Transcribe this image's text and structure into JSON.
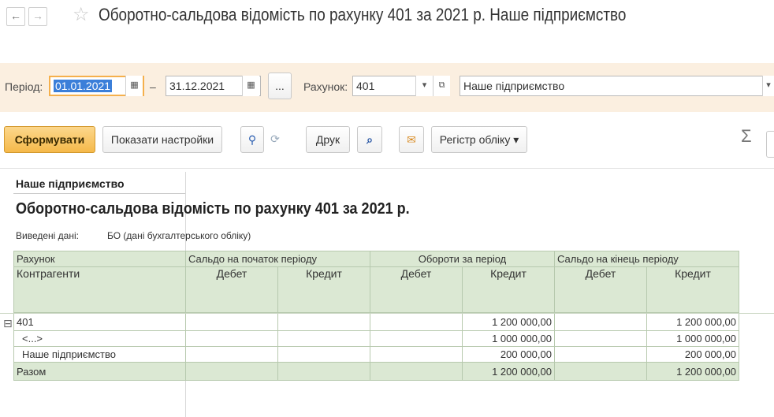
{
  "window": {
    "title": "Оборотно-сальдова відомість по рахунку 401 за 2021 р. Наше підприємство",
    "back_icon": "←",
    "forward_icon": "→",
    "favorite_icon": "☆"
  },
  "params": {
    "period_label": "Період:",
    "date_from": "01.01.2021",
    "dash": "–",
    "date_to": "31.12.2021",
    "more_btn": "...",
    "account_label": "Рахунок:",
    "account_value": "401",
    "organization_value": "Наше підприємство"
  },
  "toolbar": {
    "form_btn": "Сформувати",
    "show_settings_btn": "Показати настройки",
    "print_btn": "Друк",
    "register_btn": "Регістр обліку ▾",
    "sum_icon": "Σ"
  },
  "report": {
    "org": "Наше підприємство",
    "title": "Оборотно-сальдова відомість по рахунку 401 за 2021 р.",
    "entered_label": "Виведені дані:",
    "entered_value": "БО (дані бухгалтерського обліку)",
    "headers": {
      "account": "Рахунок",
      "counterparties": "Контрагенти",
      "opening": "Сальдо на початок періоду",
      "turnover": "Обороти за період",
      "closing": "Сальдо на кінець періоду",
      "debit": "Дебет",
      "credit": "Кредит"
    },
    "rows": [
      {
        "name": "401",
        "op_d": "",
        "op_c": "",
        "tu_d": "",
        "tu_c": "1 200 000,00",
        "cl_d": "",
        "cl_c": "1 200 000,00"
      },
      {
        "name": "<...>",
        "op_d": "",
        "op_c": "",
        "tu_d": "",
        "tu_c": "1 000 000,00",
        "cl_d": "",
        "cl_c": "1 000 000,00"
      },
      {
        "name": "Наше підприємство",
        "op_d": "",
        "op_c": "",
        "tu_d": "",
        "tu_c": "200 000,00",
        "cl_d": "",
        "cl_c": "200 000,00"
      }
    ],
    "total": {
      "name": "Разом",
      "op_d": "",
      "op_c": "",
      "tu_d": "",
      "tu_c": "1 200 000,00",
      "cl_d": "",
      "cl_c": "1 200 000,00"
    },
    "collapse_icon": "⊟"
  }
}
